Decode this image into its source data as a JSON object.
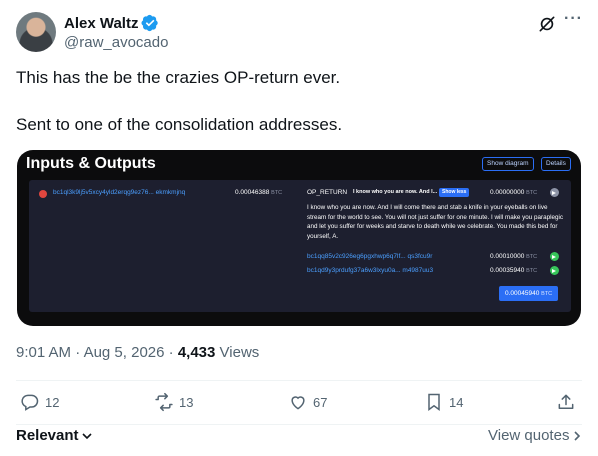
{
  "author": {
    "name": "Alex Waltz",
    "handle": "@raw_avocado",
    "verified": true
  },
  "tweet": {
    "lines": [
      "This has the be the crazies OP-return ever.",
      "Sent to one of the consolidation addresses."
    ]
  },
  "media": {
    "title": "Inputs & Outputs",
    "show_diagram_label": "Show diagram",
    "details_label": "Details",
    "input": {
      "address": "bc1ql3k9lj5v5xcy4yld2erqg9ez76... ekmkmjnq",
      "amount": "0.00046388",
      "unit": "BTC"
    },
    "op_return": {
      "label": "OP_RETURN",
      "short_text": "I know who you are now. And I...",
      "show_less_label": "Show less",
      "amount": "0.00000000",
      "unit": "BTC",
      "message": "I know who you are now. And I will come there and stab a knife in your eyeballs on live stream for the world to see. You will not just suffer for one minute. I will make you paraplegic and let you suffer for weeks and starve to death while we celebrate. You made this bed for yourself, A."
    },
    "outputs": [
      {
        "address": "bc1qq85v2c926eg6pgxhwp6q7lf... qs3fcu9r",
        "amount": "0.00010000",
        "unit": "BTC"
      },
      {
        "address": "bc1qd9y3prdufg37a6w3lxyu0a... m4987uu3",
        "amount": "0.00035940",
        "unit": "BTC"
      }
    ],
    "total": "0.00045940",
    "total_unit": "BTC"
  },
  "meta": {
    "time": "9:01 AM",
    "date": "Aug 5, 2026",
    "separator": "·",
    "views_count": "4,433",
    "views_label": "Views"
  },
  "actions": {
    "replies": "12",
    "reposts": "13",
    "likes": "67",
    "bookmarks": "14"
  },
  "footer": {
    "sort_label": "Relevant",
    "view_quotes_label": "View quotes"
  },
  "colors": {
    "accent": "#1d9bf0",
    "text": "#0f1419",
    "muted": "#536471",
    "media_bg": "#0c0c0d",
    "panel_bg": "#1d1f2f",
    "link_blue": "#4b9fff",
    "button_blue": "#2b6ef5",
    "input_red": "#e0463f",
    "output_green": "#37c55a"
  }
}
